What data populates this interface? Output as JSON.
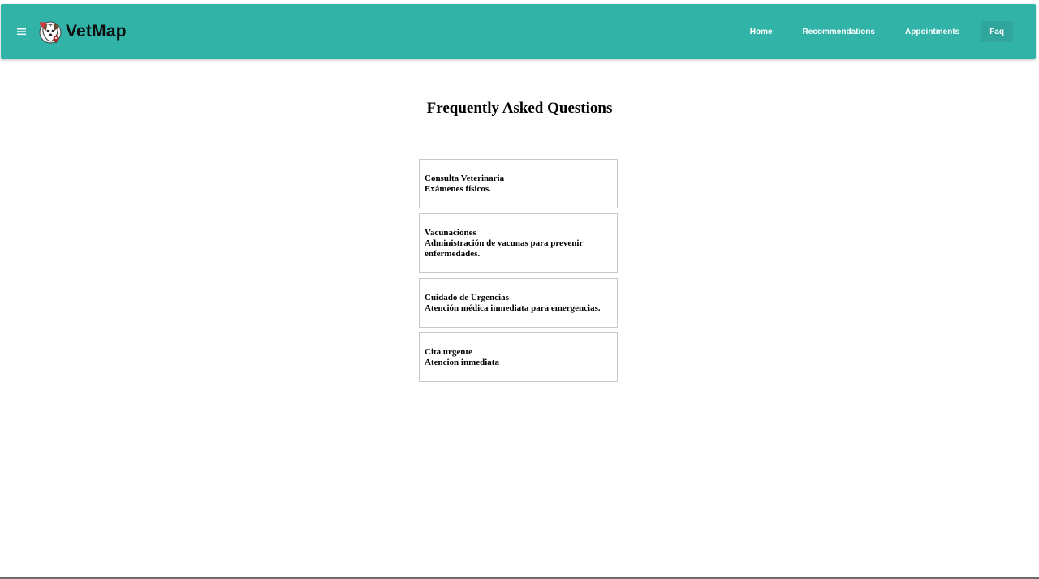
{
  "header": {
    "brand": "VetMap",
    "nav": [
      {
        "label": "Home"
      },
      {
        "label": "Recommendations"
      },
      {
        "label": "Appointments"
      },
      {
        "label": "Faq"
      }
    ],
    "active_nav": "Faq",
    "colors": {
      "toolbar": "#32b3a8",
      "active": "#2fa59b",
      "nav_text": "#ffffff"
    }
  },
  "main": {
    "title": "Frequently Asked Questions",
    "faqs": [
      {
        "question": "Consulta Veterinaria",
        "answer": "Exámenes físicos."
      },
      {
        "question": "Vacunaciones",
        "answer": "Administración de vacunas para prevenir enfermedades."
      },
      {
        "question": "Cuidado de Urgencias",
        "answer": "Atención médica inmediata para emergencias."
      },
      {
        "question": "Cita urgente",
        "answer": "Atencion inmediata"
      }
    ]
  },
  "icons": {
    "menu": "menu-icon",
    "logo": "vetmap-logo-icon"
  }
}
